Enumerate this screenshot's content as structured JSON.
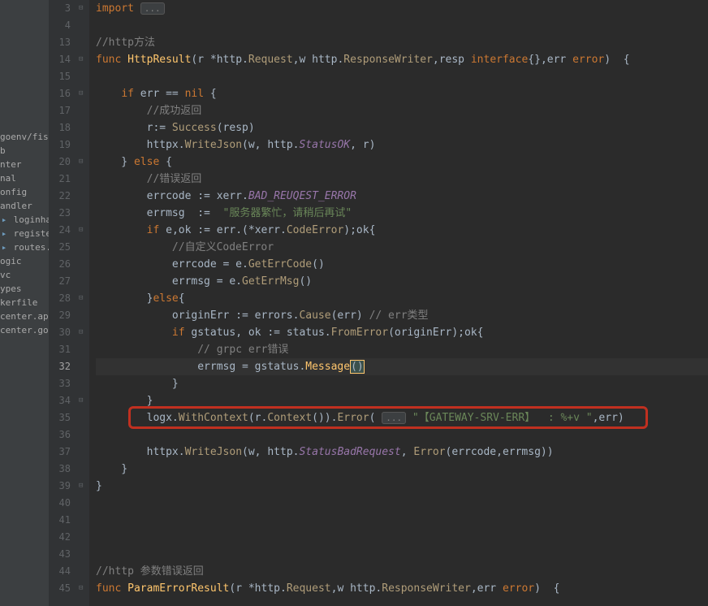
{
  "sidebar": {
    "items": [
      {
        "label": "goenv/fisht"
      },
      {
        "label": "b"
      },
      {
        "label": "nter"
      },
      {
        "label": "nal"
      },
      {
        "label": "onfig"
      },
      {
        "label": "andler"
      },
      {
        "label": "loginhan",
        "icon": "▸"
      },
      {
        "label": "registerh",
        "icon": "▸"
      },
      {
        "label": "routes.go",
        "icon": "▸"
      },
      {
        "label": "ogic"
      },
      {
        "label": "vc"
      },
      {
        "label": "ypes"
      },
      {
        "label": "kerfile"
      },
      {
        "label": "center.api"
      },
      {
        "label": "center.go"
      }
    ]
  },
  "editor": {
    "lineStart": 3,
    "currentLine": 32,
    "lines": [
      {
        "n": 3,
        "tokens": [
          {
            "t": "kw",
            "v": "import"
          },
          {
            "t": "op",
            "v": " "
          },
          {
            "t": "fold",
            "v": "..."
          }
        ]
      },
      {
        "n": 4,
        "tokens": []
      },
      {
        "n": 13,
        "tokens": [
          {
            "t": "com",
            "v": "//http方法"
          }
        ]
      },
      {
        "n": 14,
        "tokens": [
          {
            "t": "kw",
            "v": "func "
          },
          {
            "t": "fn",
            "v": "HttpResult"
          },
          {
            "t": "op",
            "v": "(r *"
          },
          {
            "t": "ident",
            "v": "http"
          },
          {
            "t": "op",
            "v": "."
          },
          {
            "t": "call",
            "v": "Request"
          },
          {
            "t": "op",
            "v": ",w "
          },
          {
            "t": "ident",
            "v": "http"
          },
          {
            "t": "op",
            "v": "."
          },
          {
            "t": "call",
            "v": "ResponseWriter"
          },
          {
            "t": "op",
            "v": ","
          },
          {
            "t": "ident",
            "v": "resp "
          },
          {
            "t": "kw",
            "v": "interface"
          },
          {
            "t": "op",
            "v": "{},"
          },
          {
            "t": "ident",
            "v": "err "
          },
          {
            "t": "kw",
            "v": "error"
          },
          {
            "t": "op",
            "v": ")  {"
          }
        ]
      },
      {
        "n": 15,
        "tokens": []
      },
      {
        "n": 16,
        "tokens": [
          {
            "t": "op",
            "v": "    "
          },
          {
            "t": "kw",
            "v": "if "
          },
          {
            "t": "ident",
            "v": "err "
          },
          {
            "t": "op",
            "v": "== "
          },
          {
            "t": "kw",
            "v": "nil"
          },
          {
            "t": "op",
            "v": " {"
          }
        ]
      },
      {
        "n": 17,
        "tokens": [
          {
            "t": "op",
            "v": "        "
          },
          {
            "t": "com",
            "v": "//成功返回"
          }
        ]
      },
      {
        "n": 18,
        "tokens": [
          {
            "t": "op",
            "v": "        r:= "
          },
          {
            "t": "call",
            "v": "Success"
          },
          {
            "t": "op",
            "v": "(resp)"
          }
        ]
      },
      {
        "n": 19,
        "tokens": [
          {
            "t": "op",
            "v": "        httpx."
          },
          {
            "t": "call",
            "v": "WriteJson"
          },
          {
            "t": "op",
            "v": "(w, http."
          },
          {
            "t": "const",
            "v": "StatusOK"
          },
          {
            "t": "op",
            "v": ", r)"
          }
        ]
      },
      {
        "n": 20,
        "tokens": [
          {
            "t": "op",
            "v": "    } "
          },
          {
            "t": "kw",
            "v": "else"
          },
          {
            "t": "op",
            "v": " {"
          }
        ]
      },
      {
        "n": 21,
        "tokens": [
          {
            "t": "op",
            "v": "        "
          },
          {
            "t": "com",
            "v": "//错误返回"
          }
        ]
      },
      {
        "n": 22,
        "tokens": [
          {
            "t": "op",
            "v": "        errcode := xerr."
          },
          {
            "t": "const",
            "v": "BAD_REUQEST_ERROR"
          }
        ]
      },
      {
        "n": 23,
        "tokens": [
          {
            "t": "op",
            "v": "        errmsg  :=  "
          },
          {
            "t": "str",
            "v": "\"服务器繁忙，请稍后再试\""
          }
        ]
      },
      {
        "n": 24,
        "tokens": [
          {
            "t": "op",
            "v": "        "
          },
          {
            "t": "kw",
            "v": "if "
          },
          {
            "t": "ident",
            "v": "e"
          },
          {
            "t": "op",
            "v": ","
          },
          {
            "t": "ident",
            "v": "ok"
          },
          {
            "t": "op",
            "v": " := err.(*xerr."
          },
          {
            "t": "call",
            "v": "CodeError"
          },
          {
            "t": "op",
            "v": ");ok{"
          }
        ]
      },
      {
        "n": 25,
        "tokens": [
          {
            "t": "op",
            "v": "            "
          },
          {
            "t": "com",
            "v": "//自定义CodeError"
          }
        ]
      },
      {
        "n": 26,
        "tokens": [
          {
            "t": "op",
            "v": "            errcode = e."
          },
          {
            "t": "call",
            "v": "GetErrCode"
          },
          {
            "t": "op",
            "v": "()"
          }
        ]
      },
      {
        "n": 27,
        "tokens": [
          {
            "t": "op",
            "v": "            errmsg = e."
          },
          {
            "t": "call",
            "v": "GetErrMsg"
          },
          {
            "t": "op",
            "v": "()"
          }
        ]
      },
      {
        "n": 28,
        "tokens": [
          {
            "t": "op",
            "v": "        }"
          },
          {
            "t": "kw",
            "v": "else"
          },
          {
            "t": "op",
            "v": "{"
          }
        ]
      },
      {
        "n": 29,
        "tokens": [
          {
            "t": "op",
            "v": "            originErr := errors."
          },
          {
            "t": "call",
            "v": "Cause"
          },
          {
            "t": "op",
            "v": "(err) "
          },
          {
            "t": "com",
            "v": "// err类型"
          }
        ]
      },
      {
        "n": 30,
        "tokens": [
          {
            "t": "op",
            "v": "            "
          },
          {
            "t": "kw",
            "v": "if "
          },
          {
            "t": "ident",
            "v": "gstatus"
          },
          {
            "t": "op",
            "v": ", ok := status."
          },
          {
            "t": "call",
            "v": "FromError"
          },
          {
            "t": "op",
            "v": "(originErr);ok{"
          }
        ]
      },
      {
        "n": 31,
        "tokens": [
          {
            "t": "op",
            "v": "                "
          },
          {
            "t": "com",
            "v": "// grpc err错误"
          }
        ]
      },
      {
        "n": 32,
        "current": true,
        "tokens": [
          {
            "t": "op",
            "v": "                errmsg = gstatus."
          },
          {
            "t": "fn",
            "v": "Message"
          },
          {
            "t": "caret",
            "v": "()"
          }
        ]
      },
      {
        "n": 33,
        "tokens": [
          {
            "t": "op",
            "v": "            }"
          }
        ]
      },
      {
        "n": 34,
        "tokens": [
          {
            "t": "op",
            "v": "        }"
          }
        ]
      },
      {
        "n": 35,
        "highlight": true,
        "tokens": [
          {
            "t": "op",
            "v": "        logx."
          },
          {
            "t": "call",
            "v": "WithContext"
          },
          {
            "t": "op",
            "v": "(r."
          },
          {
            "t": "call",
            "v": "Context"
          },
          {
            "t": "op",
            "v": "())."
          },
          {
            "t": "call",
            "v": "Error"
          },
          {
            "t": "op",
            "v": "( "
          },
          {
            "t": "fold",
            "v": "..."
          },
          {
            "t": "str",
            "v": " \"【GATEWAY-SRV-ERR】  : %+v \""
          },
          {
            "t": "op",
            "v": ",err)"
          }
        ]
      },
      {
        "n": 36,
        "tokens": []
      },
      {
        "n": 37,
        "tokens": [
          {
            "t": "op",
            "v": "        httpx."
          },
          {
            "t": "call",
            "v": "WriteJson"
          },
          {
            "t": "op",
            "v": "(w, http."
          },
          {
            "t": "const",
            "v": "StatusBadRequest"
          },
          {
            "t": "op",
            "v": ", "
          },
          {
            "t": "call",
            "v": "Error"
          },
          {
            "t": "op",
            "v": "(errcode,errmsg))"
          }
        ]
      },
      {
        "n": 38,
        "tokens": [
          {
            "t": "op",
            "v": "    }"
          }
        ]
      },
      {
        "n": 39,
        "tokens": [
          {
            "t": "op",
            "v": "}"
          }
        ]
      },
      {
        "n": 40,
        "tokens": []
      },
      {
        "n": 41,
        "tokens": []
      },
      {
        "n": 42,
        "tokens": []
      },
      {
        "n": 43,
        "tokens": []
      },
      {
        "n": 44,
        "tokens": [
          {
            "t": "com",
            "v": "//http 参数错误返回"
          }
        ]
      },
      {
        "n": 45,
        "tokens": [
          {
            "t": "kw",
            "v": "func "
          },
          {
            "t": "fn",
            "v": "ParamErrorResult"
          },
          {
            "t": "op",
            "v": "(r *http."
          },
          {
            "t": "call",
            "v": "Request"
          },
          {
            "t": "op",
            "v": ",w http."
          },
          {
            "t": "call",
            "v": "ResponseWriter"
          },
          {
            "t": "op",
            "v": ",err "
          },
          {
            "t": "kw",
            "v": "error"
          },
          {
            "t": "op",
            "v": ")  {"
          }
        ]
      }
    ],
    "foldMarks": [
      3,
      14,
      16,
      20,
      24,
      28,
      30,
      34,
      39,
      45
    ]
  }
}
